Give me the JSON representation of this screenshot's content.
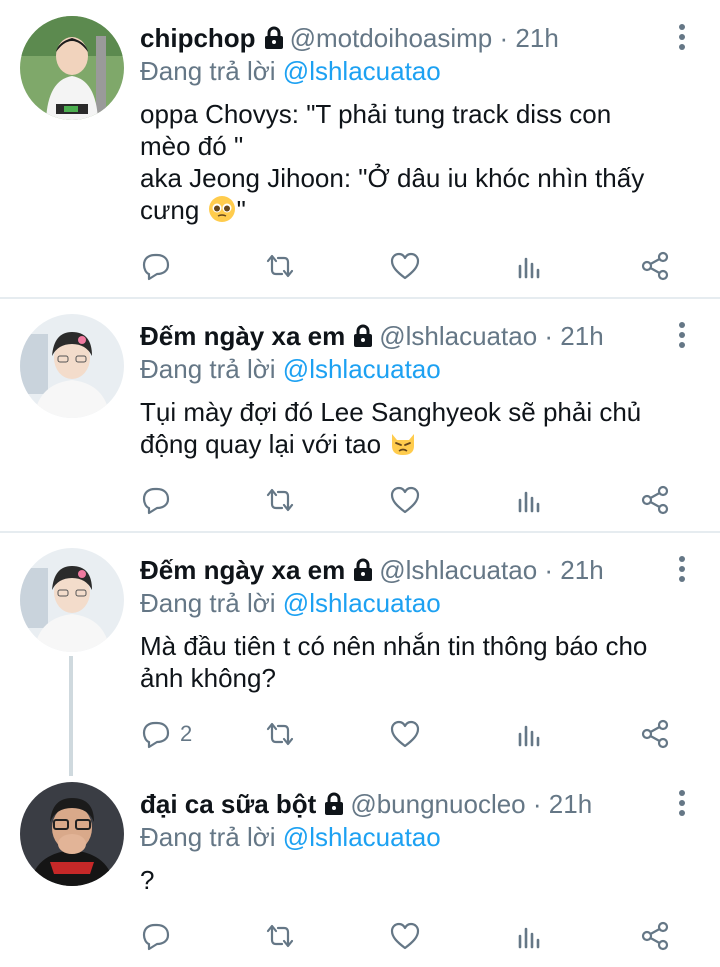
{
  "colors": {
    "link": "#1da1f2",
    "muted": "#657786",
    "text": "#0f1419",
    "divider": "#e6ecf0"
  },
  "tweets": [
    {
      "name": "chipchop",
      "handle": "@motdoihoasimp",
      "dot": "·",
      "time": "21h",
      "reply_prefix": "Đang trả lời",
      "reply_to": "@lshlacuatao",
      "lines": [
        "oppa Chovys: \"T phải tung track diss con",
        "mèo đó \"",
        "aka Jeong Jihoon: \"Ở dâu iu khóc nhìn thấy",
        "cưng "
      ],
      "line4_suffix": "\"",
      "emoji": "pleading-face-emoji",
      "reply_count": ""
    },
    {
      "name": "Đếm ngày xa em",
      "handle": "@lshlacuatao",
      "dot": "·",
      "time": "21h",
      "reply_prefix": "Đang trả lời",
      "reply_to": "@lshlacuatao",
      "lines": [
        "Tụi mày đợi đó Lee Sanghyeok sẽ phải chủ",
        "động quay lại với tao "
      ],
      "emoji": "pouting-cat-emoji",
      "reply_count": ""
    },
    {
      "name": "Đếm ngày xa em",
      "handle": "@lshlacuatao",
      "dot": "·",
      "time": "21h",
      "reply_prefix": "Đang trả lời",
      "reply_to": "@lshlacuatao",
      "lines": [
        "Mà đầu tiên t có nên nhắn tin thông báo cho",
        "ảnh không?"
      ],
      "reply_count": "2"
    },
    {
      "name": "đại ca sữa bột",
      "handle": "@bungnuocleo",
      "dot": "·",
      "time": "21h",
      "reply_prefix": "Đang trả lời",
      "reply_to": "@lshlacuatao",
      "lines": [
        "?"
      ],
      "reply_count": ""
    }
  ],
  "icons": [
    "reply-icon",
    "retweet-icon",
    "like-icon",
    "analytics-icon",
    "share-icon",
    "lock-icon",
    "more-options-icon"
  ]
}
